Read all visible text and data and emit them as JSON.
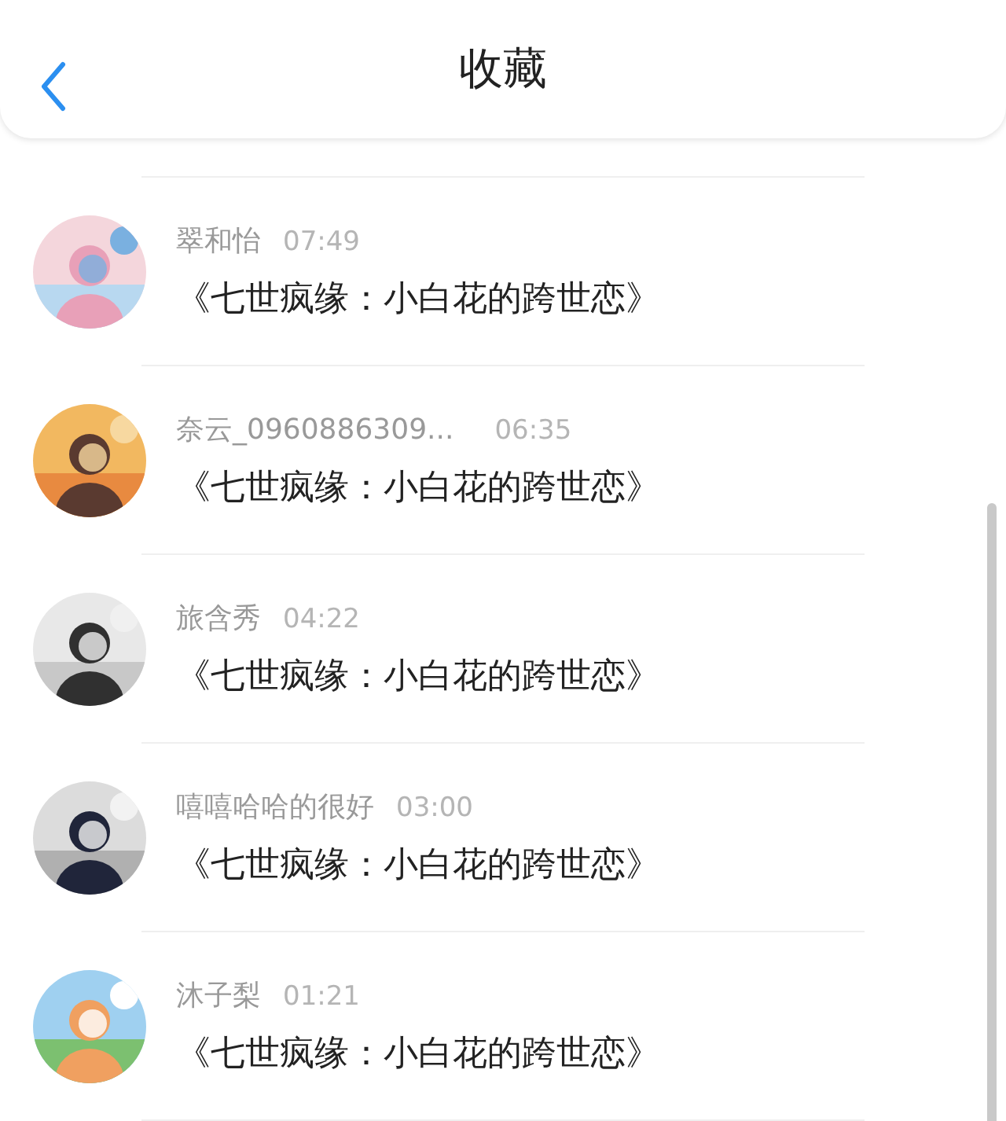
{
  "header": {
    "title": "收藏"
  },
  "items": [
    {
      "name": "翠和怡",
      "time": "07:49",
      "title": "《七世疯缘：小白花的跨世恋》"
    },
    {
      "name": "奈云_0960886309...",
      "time": "06:35",
      "title": "《七世疯缘：小白花的跨世恋》"
    },
    {
      "name": "旅含秀",
      "time": "04:22",
      "title": "《七世疯缘：小白花的跨世恋》"
    },
    {
      "name": "嘻嘻哈哈的很好",
      "time": "03:00",
      "title": "《七世疯缘：小白花的跨世恋》"
    },
    {
      "name": "沐子梨",
      "time": "01:21",
      "title": "《七世疯缘：小白花的跨世恋》"
    }
  ]
}
